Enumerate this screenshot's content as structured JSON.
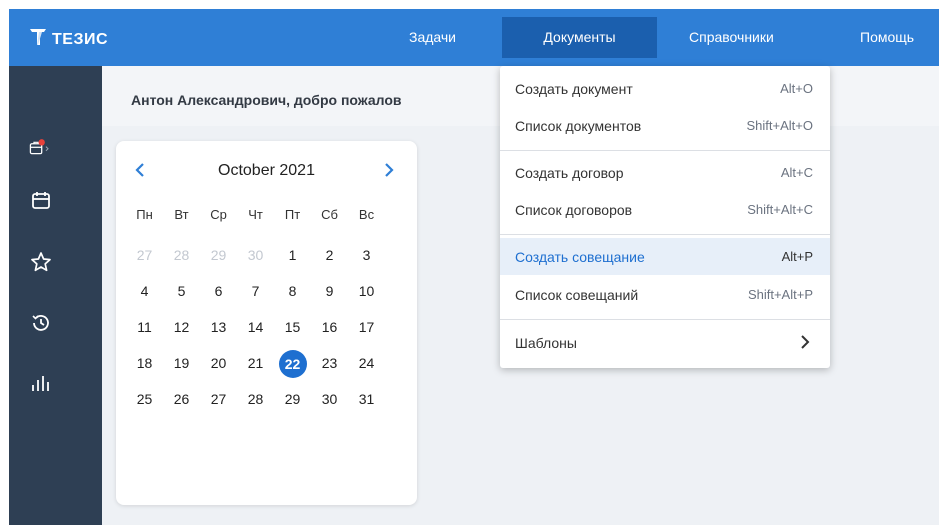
{
  "app": {
    "logo_text": "ТЕЗИС"
  },
  "nav": {
    "tasks": "Задачи",
    "documents": "Документы",
    "references": "Справочники",
    "help": "Помощь"
  },
  "sidebar": {
    "icons": [
      "briefcase-notification-icon",
      "calendar-icon",
      "star-icon",
      "history-icon",
      "chart-icon"
    ]
  },
  "welcome": {
    "text": "Антон Александрович, добро пожалов"
  },
  "calendar": {
    "title": "October 2021",
    "prev_label": "‹",
    "next_label": "›",
    "weekdays": [
      "Пн",
      "Вт",
      "Ср",
      "Чт",
      "Пт",
      "Сб",
      "Вс"
    ],
    "weeks": [
      [
        "27",
        "28",
        "29",
        "30",
        "1",
        "2",
        "3"
      ],
      [
        "4",
        "5",
        "6",
        "7",
        "8",
        "9",
        "10"
      ],
      [
        "11",
        "12",
        "13",
        "14",
        "15",
        "16",
        "17"
      ],
      [
        "18",
        "19",
        "20",
        "21",
        "22",
        "23",
        "24"
      ],
      [
        "25",
        "26",
        "27",
        "28",
        "29",
        "30",
        "31"
      ]
    ],
    "today": "22"
  },
  "dropdown": {
    "items": [
      {
        "label": "Создать документ",
        "shortcut": "Alt+O"
      },
      {
        "label": "Список документов",
        "shortcut": "Shift+Alt+O"
      },
      {
        "label": "Создать договор",
        "shortcut": "Alt+C"
      },
      {
        "label": "Список договоров",
        "shortcut": "Shift+Alt+C"
      },
      {
        "label": "Создать совещание",
        "shortcut": "Alt+P"
      },
      {
        "label": "Список совещаний",
        "shortcut": "Shift+Alt+P"
      },
      {
        "label": "Шаблоны",
        "shortcut": ""
      }
    ],
    "active_index": 4
  },
  "colors": {
    "topbar": "#2f7fd6",
    "nav_active": "#1b5fae",
    "sidebar": "#2e3f54",
    "accent": "#1e6fd0",
    "notification": "#e8403a"
  }
}
